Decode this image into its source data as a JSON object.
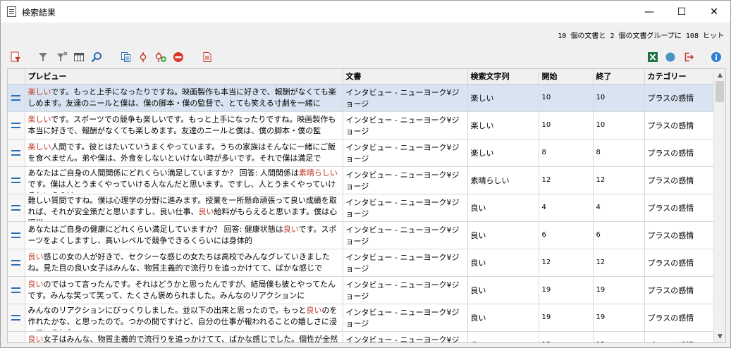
{
  "window": {
    "title": "検索結果",
    "minimize_glyph": "—",
    "maximize_glyph": "☐",
    "close_glyph": "✕"
  },
  "summary": "10 個の文書と 2 個の文書グループに 108 ヒット",
  "toolbar": {
    "left": [
      "filter-doc-icon",
      "funnel-icon",
      "funnel-clear-icon",
      "columns-icon",
      "search-icon",
      "copy-docs-icon",
      "pin-icon",
      "pin-add-icon",
      "remove-icon",
      "report-icon"
    ],
    "right": [
      "excel-icon",
      "globe-icon",
      "exit-icon",
      "info-icon"
    ]
  },
  "colors": {
    "accent": "#2f6eb4",
    "hit_text": "#c0392b",
    "selected_row": "#d9e4f2"
  },
  "columns": {
    "preview": "プレビュー",
    "document": "文書",
    "search_string": "検索文字列",
    "start": "開始",
    "end": "終了",
    "category": "カテゴリー"
  },
  "rows": [
    {
      "selected": true,
      "pre": "",
      "hit": "楽しい",
      "post": "です。もっと上手になったりですね。映画製作も本当に好きで、報酬がなくても楽しめます。友達のニールと僕は、僕の脚本・僕の監督で、とても笑える寸劇を一緒に",
      "document": "インタビュー - ニューヨーク¥ジョージ",
      "search_string": "楽しい",
      "start": "10",
      "end": "10",
      "category": "プラスの感情"
    },
    {
      "selected": false,
      "pre": "",
      "hit": "楽しい",
      "post": "です。スポーツでの競争も楽しいです。もっと上手になったりですね。映画製作も本当に好きで、報酬がなくても楽しめます。友達のニールと僕は、僕の脚本・僕の監",
      "document": "インタビュー - ニューヨーク¥ジョージ",
      "search_string": "楽しい",
      "start": "10",
      "end": "10",
      "category": "プラスの感情"
    },
    {
      "selected": false,
      "pre": "",
      "hit": "楽しい",
      "post": "人間です。彼とはたいていうまくやっています。うちの家族はそんなに一緒にご飯を食べません。弟や僕は、外食をしないといけない時が多いです。それで僕は満足で",
      "document": "インタビュー - ニューヨーク¥ジョージ",
      "search_string": "楽しい",
      "start": "8",
      "end": "8",
      "category": "プラスの感情"
    },
    {
      "selected": false,
      "pre": " あなたはご自身の人間関係にどれくらい満足していますか？ 回答: 人間関係は",
      "hit": "素晴らしい",
      "post": "です。僕は人とうまくやっていける人なんだと思います。ですし、人とうまくやっていけるというのは",
      "document": "インタビュー - ニューヨーク¥ジョージ",
      "search_string": "素晴らしい",
      "start": "12",
      "end": "12",
      "category": "プラスの感情"
    },
    {
      "selected": false,
      "pre": " 難しい質問ですね。僕は心理学の分野に進みます。授業を一所懸命頑張って良い成績を取れば、それが安全策だと思いますし、良い仕事、",
      "hit": "良い",
      "post": "給料がもらえると思います。僕は心理学",
      "document": "インタビュー - ニューヨーク¥ジョージ",
      "search_string": "良い",
      "start": "4",
      "end": "4",
      "category": "プラスの感情"
    },
    {
      "selected": false,
      "pre": " あなたはご自身の健康にどれくらい満足していますか？ 回答: 健康状態は",
      "hit": "良い",
      "post": "です。スポーツをよくしますし、高いレベルで競争できるくらいには身体的",
      "document": "インタビュー - ニューヨーク¥ジョージ",
      "search_string": "良い",
      "start": "6",
      "end": "6",
      "category": "プラスの感情"
    },
    {
      "selected": false,
      "pre": "",
      "hit": "良い",
      "post": "感じの女の人が好きで、セクシーな感じの女たちは高校でみんなグレていきましたね。見た目の良い女子はみんな、物質主義的で流行りを追っかけてて、ばかな感じで",
      "document": "インタビュー - ニューヨーク¥ジョージ",
      "search_string": "良い",
      "start": "12",
      "end": "12",
      "category": "プラスの感情"
    },
    {
      "selected": false,
      "pre": "",
      "hit": "良い",
      "post": "のではって言ったんです。それはどうかと思ったんですが、結局僕も彼とやってたんです。みんな笑って笑って、たくさん褒められました。みんなのリアクションに",
      "document": "インタビュー - ニューヨーク¥ジョージ",
      "search_string": "良い",
      "start": "19",
      "end": "19",
      "category": "プラスの感情"
    },
    {
      "selected": false,
      "pre": " みんなのリアクションにびっくりしました。並以下の出来と思ったので。もっと",
      "hit": "良い",
      "post": "のを作れたかな、と思ったので。つかの間ですけど、自分の仕事が報われることの嬉しさに浸っていました。",
      "document": "インタビュー - ニューヨーク¥ジョージ",
      "search_string": "良い",
      "start": "19",
      "end": "19",
      "category": "プラスの感情"
    },
    {
      "selected": false,
      "pre": "",
      "hit": "良い",
      "post": "女子はみんな、物質主義的で流行りを追っかけてて、ばかな感じでした。個性が全然な",
      "document": "インタビュー - ニューヨーク¥ジョージ",
      "search_string": "良い",
      "start": "12",
      "end": "12",
      "category": "プラスの感情"
    }
  ],
  "scrollbar": {
    "up": "▲",
    "down": "▼"
  }
}
